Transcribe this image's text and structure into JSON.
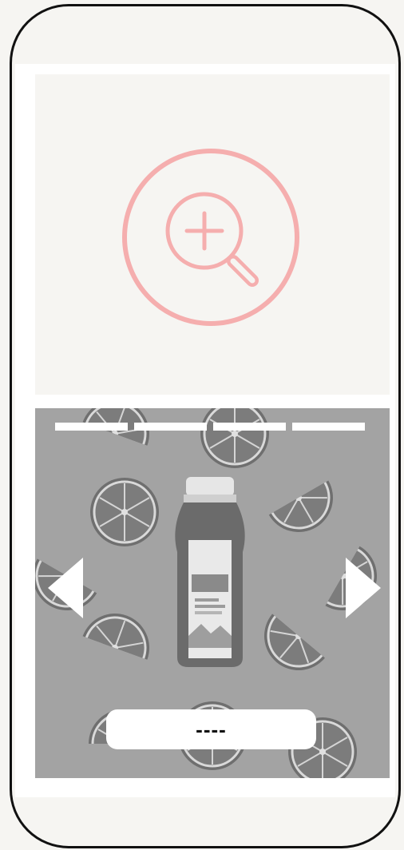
{
  "colors": {
    "page_background": "#f6f5f2",
    "frame_border": "#111111",
    "zoom_accent": "#f5aeae",
    "gallery_overlay": "#9a9a9a",
    "progress_segment": "#ffffff"
  },
  "zoom_panel": {
    "icon": "zoom-in-magnifier-icon"
  },
  "gallery": {
    "image": "orange-juice-bottle-photo",
    "progress_segments": 4,
    "prev_icon": "chevron-left-icon",
    "next_icon": "chevron-right-icon",
    "caption_label": "----"
  }
}
